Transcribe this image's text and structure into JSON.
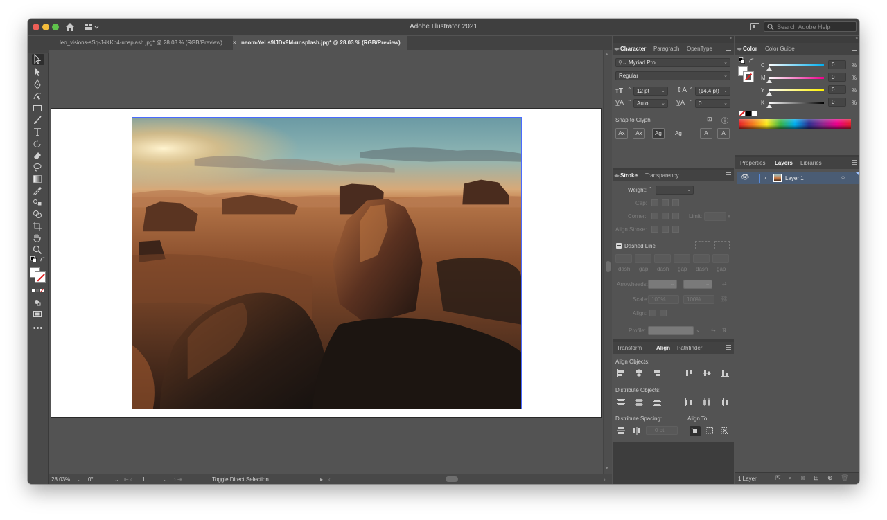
{
  "window": {
    "title": "Adobe Illustrator 2021",
    "help_placeholder": "Search Adobe Help"
  },
  "tabs": [
    {
      "label": "leo_visions-sSq-J-iKKb4-unsplash.jpg* @ 28.03 % (RGB/Preview)",
      "active": false
    },
    {
      "label": "neom-YeLs9lJDx9M-unsplash.jpg* @ 28.03 % (RGB/Preview)",
      "active": true
    }
  ],
  "statusbar": {
    "zoom": "28.03%",
    "rotation": "0°",
    "artboard": "1",
    "status_text": "Toggle Direct Selection"
  },
  "character": {
    "tabs": [
      "Character",
      "Paragraph",
      "OpenType"
    ],
    "font_family": "Myriad Pro",
    "font_style": "Regular",
    "font_size": "12 pt",
    "leading": "(14.4 pt)",
    "kerning": "Auto",
    "tracking": "0",
    "snap_label": "Snap to Glyph"
  },
  "stroke": {
    "tabs": [
      "Stroke",
      "Transparency"
    ],
    "weight_label": "Weight:",
    "cap_label": "Cap:",
    "corner_label": "Corner:",
    "limit_label": "Limit:",
    "limit_x": "x",
    "align_stroke_label": "Align Stroke:",
    "dashed_line_label": "Dashed Line",
    "dash_labels": [
      "dash",
      "gap",
      "dash",
      "gap",
      "dash",
      "gap"
    ],
    "arrowheads_label": "Arrowheads:",
    "scale_label": "Scale:",
    "scale_values": [
      "100%",
      "100%"
    ],
    "align_label": "Align:",
    "profile_label": "Profile:"
  },
  "align": {
    "tabs": [
      "Transform",
      "Align",
      "Pathfinder"
    ],
    "align_objects_label": "Align Objects:",
    "distribute_objects_label": "Distribute Objects:",
    "distribute_spacing_label": "Distribute Spacing:",
    "align_to_label": "Align To:",
    "spacing_value": "0 pt"
  },
  "color": {
    "tabs": [
      "Color",
      "Color Guide"
    ],
    "channels": [
      {
        "label": "C",
        "value": "0",
        "unit": "%"
      },
      {
        "label": "M",
        "value": "0",
        "unit": "%"
      },
      {
        "label": "Y",
        "value": "0",
        "unit": "%"
      },
      {
        "label": "K",
        "value": "0",
        "unit": "%"
      }
    ]
  },
  "layers": {
    "tabs": [
      "Properties",
      "Layers",
      "Libraries"
    ],
    "items": [
      {
        "name": "Layer 1"
      }
    ],
    "count_label": "1 Layer"
  }
}
